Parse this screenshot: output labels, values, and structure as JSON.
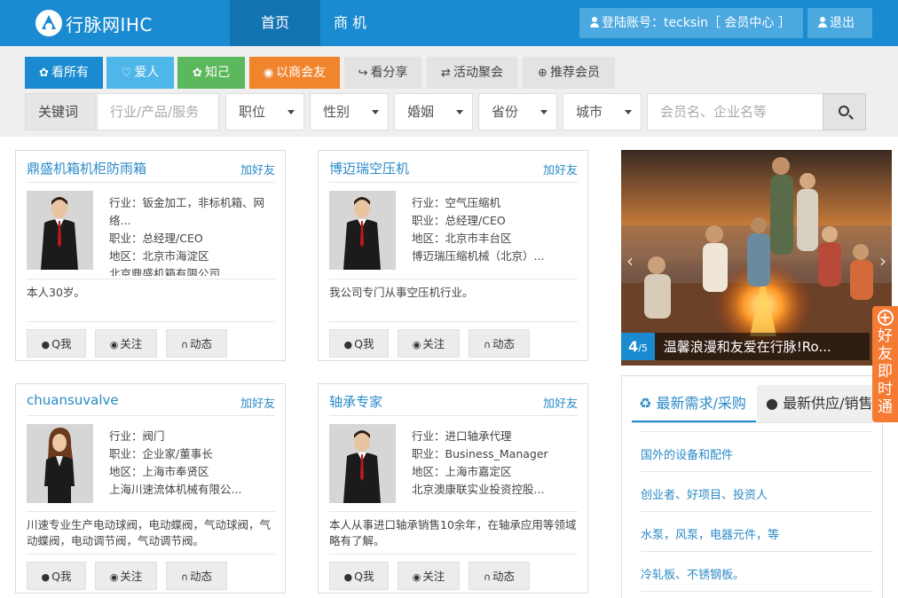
{
  "header": {
    "logo_text": "行脉网IHC",
    "nav": [
      {
        "label": "首页 HOME"
      },
      {
        "label": "商 机"
      }
    ],
    "account_label": "登陆账号：tecksin［ 会员中心 ］",
    "logout_label": "退出"
  },
  "tabs": [
    {
      "label": "看所有",
      "icon": "paw-icon",
      "color": "#1a8bd0"
    },
    {
      "label": "爱人",
      "icon": "heart-icon",
      "color": "#4eb6e8"
    },
    {
      "label": "知己",
      "icon": "paw-icon",
      "color": "#5cb85c"
    },
    {
      "label": "以商会友",
      "icon": "globe-icon",
      "color": "#f0852e"
    },
    {
      "label": "看分享",
      "icon": "share-icon",
      "color": "#e3e3e3"
    },
    {
      "label": "活动聚会",
      "icon": "retweet-icon",
      "color": "#e3e3e3"
    },
    {
      "label": "推荐会员",
      "icon": "user-plus-icon",
      "color": "#e3e3e3"
    }
  ],
  "filters": {
    "keyword_label": "关键词",
    "keyword_placeholder": "行业/产品/服务",
    "position": "职位",
    "gender": "性别",
    "marriage": "婚姻",
    "province": "省份",
    "city": "城市",
    "name_placeholder": "会员名、企业名等"
  },
  "cards": [
    {
      "name": "鼎盛机箱机柜防雨箱",
      "add": "加好友",
      "industry": "行业：钣金加工，非标机箱、网络...",
      "position": "职业：总经理/CEO",
      "region": "地区：北京市海淀区",
      "company": "北京鼎盛机箱有限公司",
      "desc": "本人30岁。",
      "actions": [
        "Q我",
        "关注",
        "动态"
      ]
    },
    {
      "name": "博迈瑞空压机",
      "add": "加好友",
      "industry": "行业：空气压缩机",
      "position": "职业：总经理/CEO",
      "region": "地区：北京市丰台区",
      "company": "博迈瑞压缩机械（北京）...",
      "desc": "我公司专门从事空压机行业。",
      "actions": [
        "Q我",
        "关注",
        "动态"
      ]
    },
    {
      "name": "chuansuvalve",
      "add": "加好友",
      "industry": "行业：阀门",
      "position": "职业：企业家/董事长",
      "region": "地区：上海市奉贤区",
      "company": "上海川速流体机械有限公...",
      "desc": "川速专业生产电动球阀，电动蝶阀，气动球阀，气动蝶阀，电动调节阀，气动调节阀。",
      "actions": [
        "Q我",
        "关注",
        "动态"
      ]
    },
    {
      "name": "轴承专家",
      "add": "加好友",
      "industry": "行业：进口轴承代理",
      "position": "职业：Business_Manager",
      "region": "地区：上海市嘉定区",
      "company": "北京澳康联实业投资控股...",
      "desc": "本人从事进口轴承销售10余年，在轴承应用等领域略有了解。",
      "actions": [
        "Q我",
        "关注",
        "动态"
      ]
    }
  ],
  "slider": {
    "current": "4",
    "total": "/5",
    "caption": "温馨浪漫和友爱在行脉!Ro..."
  },
  "demand": {
    "tab_active": "最新需求/采购",
    "tab_other": "最新供应/销售",
    "items": [
      "国外的设备和配件",
      "创业者、好项目、投资人",
      "水泵，风泵，电器元件，等",
      "冷轧板、不锈钢板。"
    ]
  },
  "friend_bar": {
    "chars": [
      "好",
      "友",
      "即",
      "时",
      "通"
    ]
  }
}
